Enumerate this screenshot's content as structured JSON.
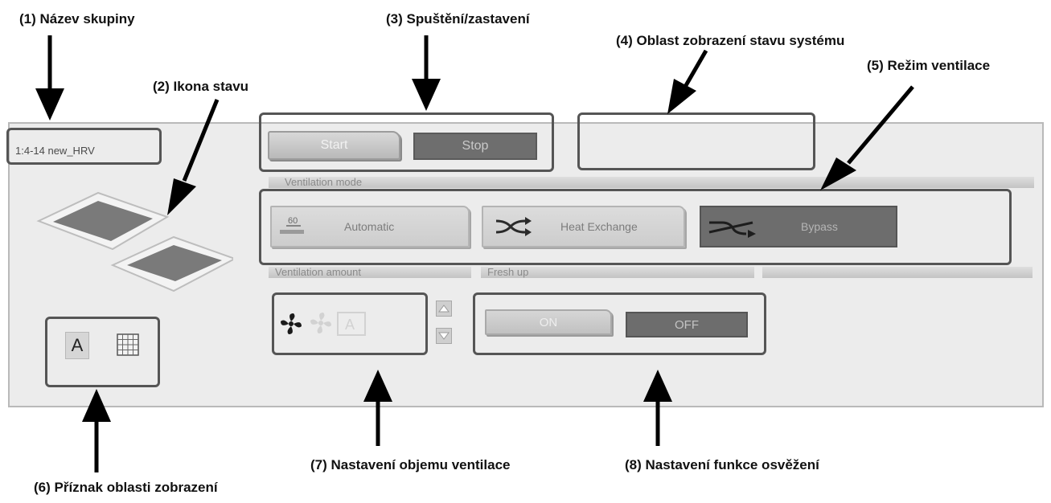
{
  "callouts": {
    "group_name": "(1) Název skupiny",
    "status_icon": "(2) Ikona stavu",
    "start_stop": "(3) Spuštění/zastavení",
    "system_status": "(4) Oblast zobrazení stavu systému",
    "vent_mode": "(5) Režim ventilace",
    "display_flag": "(6) Příznak oblasti zobrazení",
    "vent_amount": "(7) Nastavení objemu ventilace",
    "fresh_up": "(8) Nastavení funkce osvěžení"
  },
  "panel": {
    "group_name": "1:4-14 new_HRV",
    "start_label": "Start",
    "stop_label": "Stop",
    "system_status_text": "",
    "ventilation_mode_header": "Ventilation mode",
    "modes": {
      "automatic": "Automatic",
      "heat_exchange": "Heat Exchange",
      "bypass": "Bypass"
    },
    "ventilation_amount_header": "Ventilation amount",
    "fresh_up_header": "Fresh up",
    "fresh_on_label": "ON",
    "fresh_off_label": "OFF",
    "flag_letter": "A"
  },
  "icons": {
    "status": "ceiling-cassette-unit-icon",
    "auto": "auto-mode-icon",
    "heat_exchange": "heat-exchange-icon",
    "bypass": "bypass-icon",
    "fan": "fan-icon",
    "up": "triangle-up-icon",
    "down": "triangle-down-icon",
    "grid": "grid-icon"
  },
  "colors": {
    "panel_bg": "#ececec",
    "active_dark": "#6d6d6d",
    "frame": "#555555"
  }
}
